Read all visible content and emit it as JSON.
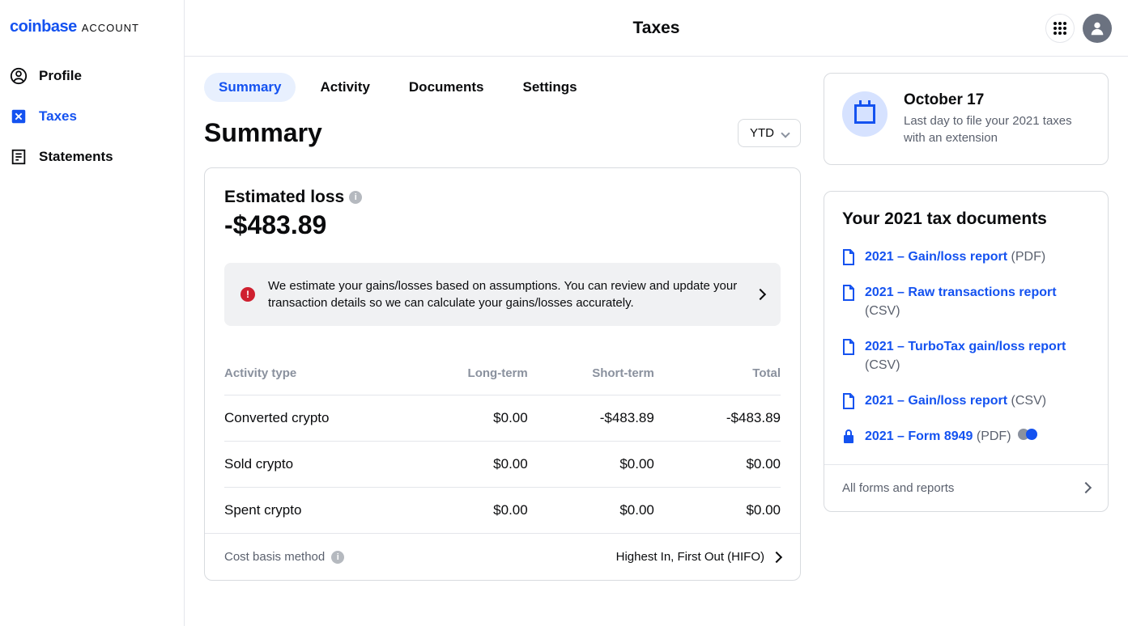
{
  "brand": {
    "name": "coinbase",
    "sub": "ACCOUNT"
  },
  "page_title": "Taxes",
  "sidebar": {
    "items": [
      {
        "label": "Profile"
      },
      {
        "label": "Taxes"
      },
      {
        "label": "Statements"
      }
    ]
  },
  "tabs": [
    {
      "label": "Summary"
    },
    {
      "label": "Activity"
    },
    {
      "label": "Documents"
    },
    {
      "label": "Settings"
    }
  ],
  "summary": {
    "heading": "Summary",
    "period": "YTD",
    "estimate_title": "Estimated loss",
    "estimate_value": "-$483.89",
    "alert_text": "We estimate your gains/losses based on assumptions. You can review and update your transaction details so we can calculate your gains/losses accurately.",
    "columns": {
      "activity": "Activity type",
      "long_term": "Long-term",
      "short_term": "Short-term",
      "total": "Total"
    },
    "rows": [
      {
        "activity": "Converted crypto",
        "long": "$0.00",
        "short": "-$483.89",
        "total": "-$483.89"
      },
      {
        "activity": "Sold crypto",
        "long": "$0.00",
        "short": "$0.00",
        "total": "$0.00"
      },
      {
        "activity": "Spent crypto",
        "long": "$0.00",
        "short": "$0.00",
        "total": "$0.00"
      }
    ],
    "cost_basis_label": "Cost basis method",
    "cost_basis_value": "Highest In, First Out (HIFO)"
  },
  "deadline": {
    "title": "October 17",
    "text": "Last day to file your 2021 taxes with an extension"
  },
  "documents": {
    "heading": "Your 2021 tax documents",
    "items": [
      {
        "name": "2021 – Gain/loss report",
        "ext": "(PDF)",
        "locked": false
      },
      {
        "name": "2021 – Raw transactions report",
        "ext": "(CSV)",
        "locked": false
      },
      {
        "name": "2021 – TurboTax gain/loss report",
        "ext": "(CSV)",
        "locked": false
      },
      {
        "name": "2021 – Gain/loss report",
        "ext": "(CSV)",
        "locked": false
      },
      {
        "name": "2021 – Form 8949",
        "ext": "(PDF)",
        "locked": true
      }
    ],
    "footer": "All forms and reports"
  }
}
